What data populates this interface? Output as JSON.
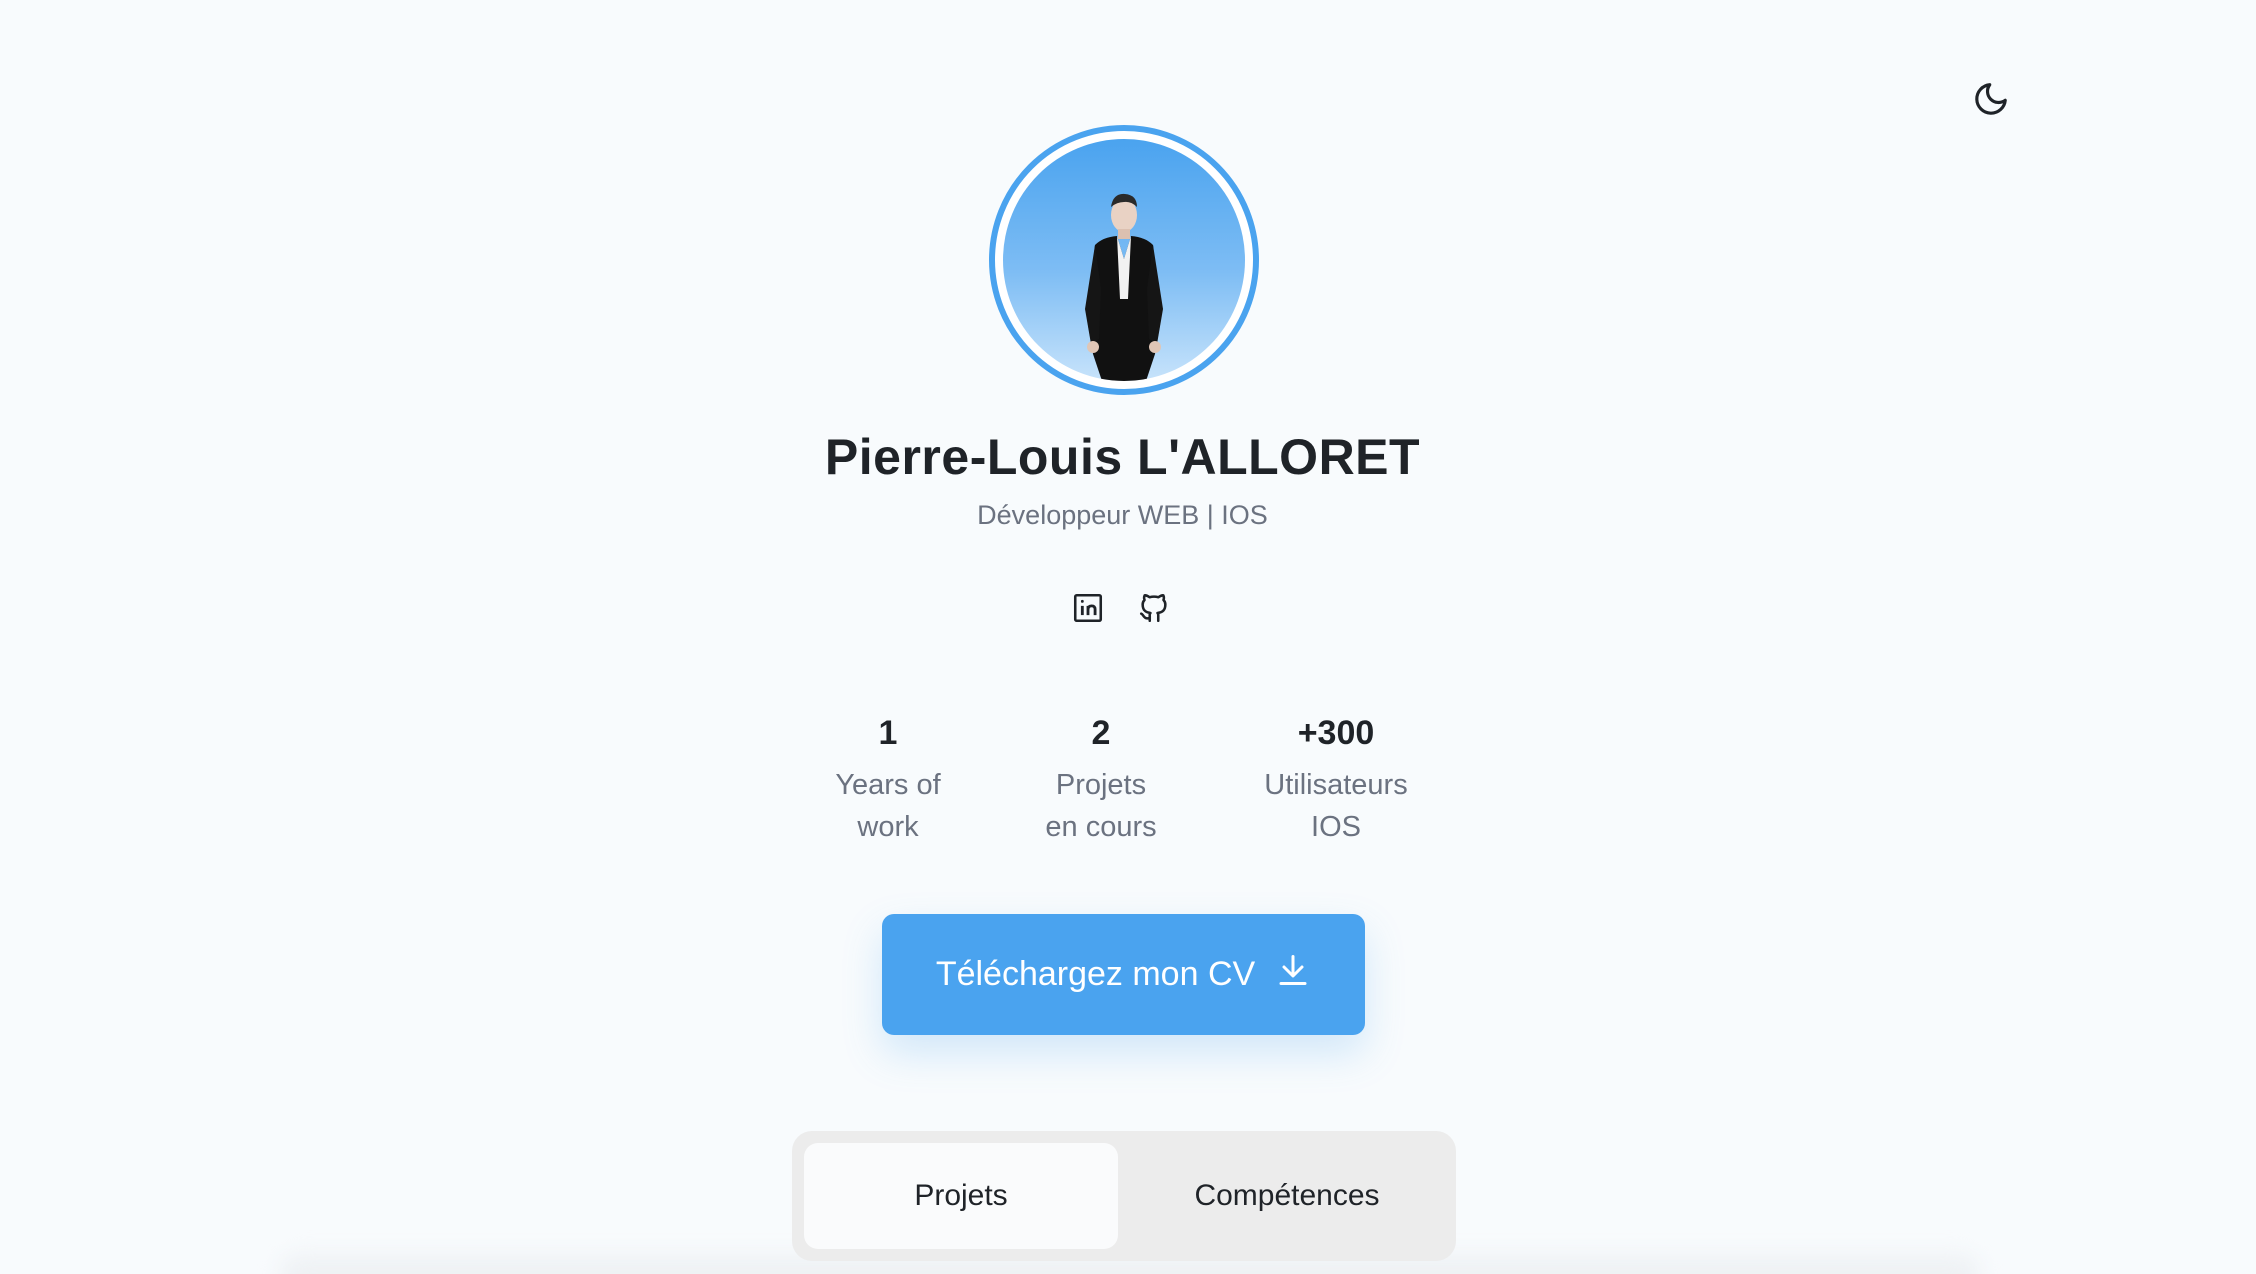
{
  "header": {
    "theme_toggle_icon": "moon-icon"
  },
  "profile": {
    "avatar_icon": "person-in-suit-photo",
    "name": "Pierre-Louis L'ALLORET",
    "subtitle": "Développeur WEB | IOS",
    "socials": [
      {
        "icon": "linkedin-icon"
      },
      {
        "icon": "github-icon"
      }
    ]
  },
  "stats": [
    {
      "value": "1",
      "label_line1": "Years of",
      "label_line2": "work"
    },
    {
      "value": "2",
      "label_line1": "Projets",
      "label_line2": "en cours"
    },
    {
      "value": "+300",
      "label_line1": "Utilisateurs",
      "label_line2": "IOS"
    }
  ],
  "cv_button": {
    "label": "Téléchargez mon CV",
    "icon": "download-icon"
  },
  "tabs": [
    {
      "label": "Projets",
      "active": true
    },
    {
      "label": "Compétences",
      "active": false
    }
  ],
  "colors": {
    "accent": "#4aa3ef",
    "background": "#f8fbfd",
    "text": "#1f2328",
    "muted": "#6b7280"
  }
}
